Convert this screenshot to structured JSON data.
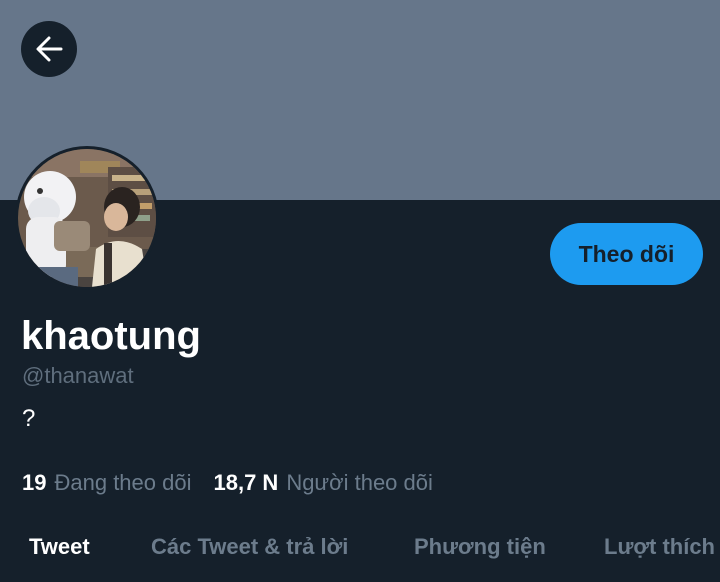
{
  "header": {
    "back_icon": "arrow-left-icon",
    "banner_color": "#66768a"
  },
  "profile": {
    "avatar": "profile-photo",
    "follow_label": "Theo dõi",
    "display_name": "khaotung",
    "handle": "@thanawat",
    "bio": "?",
    "following_count": "19",
    "following_label": "Đang theo dõi",
    "followers_count": "18,7 N",
    "followers_label": "Người theo dõi"
  },
  "tabs": [
    {
      "label": "Tweet",
      "active": true
    },
    {
      "label": "Các Tweet & trả lời",
      "active": false
    },
    {
      "label": "Phương tiện",
      "active": false
    },
    {
      "label": "Lượt thích",
      "active": false
    }
  ],
  "colors": {
    "background": "#15202b",
    "accent": "#1d9bf0",
    "muted_text": "#6c7c8c"
  }
}
